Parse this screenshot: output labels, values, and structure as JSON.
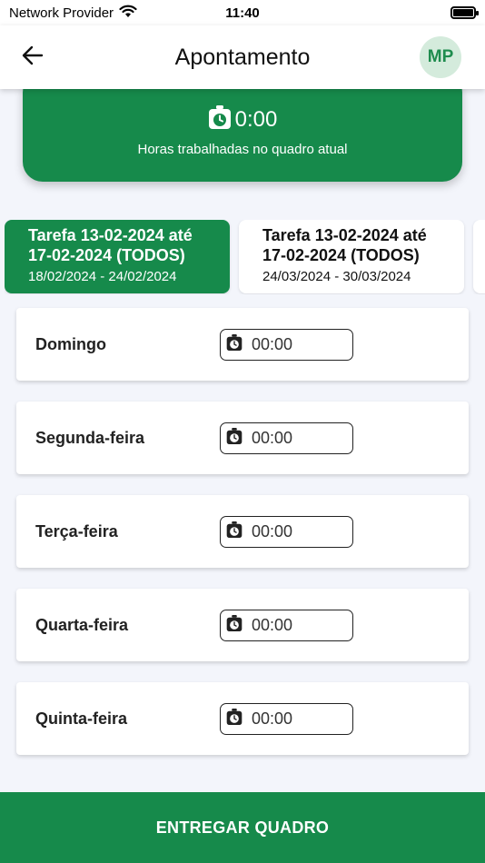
{
  "status_bar": {
    "carrier": "Network Provider",
    "time": "11:40",
    "icons": [
      "wifi-icon",
      "battery-icon"
    ]
  },
  "app_bar": {
    "title": "Apontamento",
    "back_icon": "arrow-left-icon",
    "avatar_initials": "MP"
  },
  "summary": {
    "hours_value": "0:00",
    "hours_caption": "Horas trabalhadas no quadro atual",
    "icon": "stopwatch-icon"
  },
  "tabs": [
    {
      "title": "Tarefa 13-02-2024 até 17-02-2024 (TODOS)",
      "dates": "18/02/2024 - 24/02/2024",
      "selected": true
    },
    {
      "title": "Tarefa 13-02-2024 até 17-02-2024 (TODOS)",
      "dates": "24/03/2024 - 30/03/2024",
      "selected": false
    }
  ],
  "days": [
    {
      "label": "Domingo",
      "time": "00:00"
    },
    {
      "label": "Segunda-feira",
      "time": "00:00"
    },
    {
      "label": "Terça-feira",
      "time": "00:00"
    },
    {
      "label": "Quarta-feira",
      "time": "00:00"
    },
    {
      "label": "Quinta-feira",
      "time": "00:00"
    }
  ],
  "submit_label": "ENTREGAR QUADRO",
  "colors": {
    "primary": "#168a4b",
    "avatar_bg": "#d4ebdc",
    "background": "#f3f5fb"
  }
}
